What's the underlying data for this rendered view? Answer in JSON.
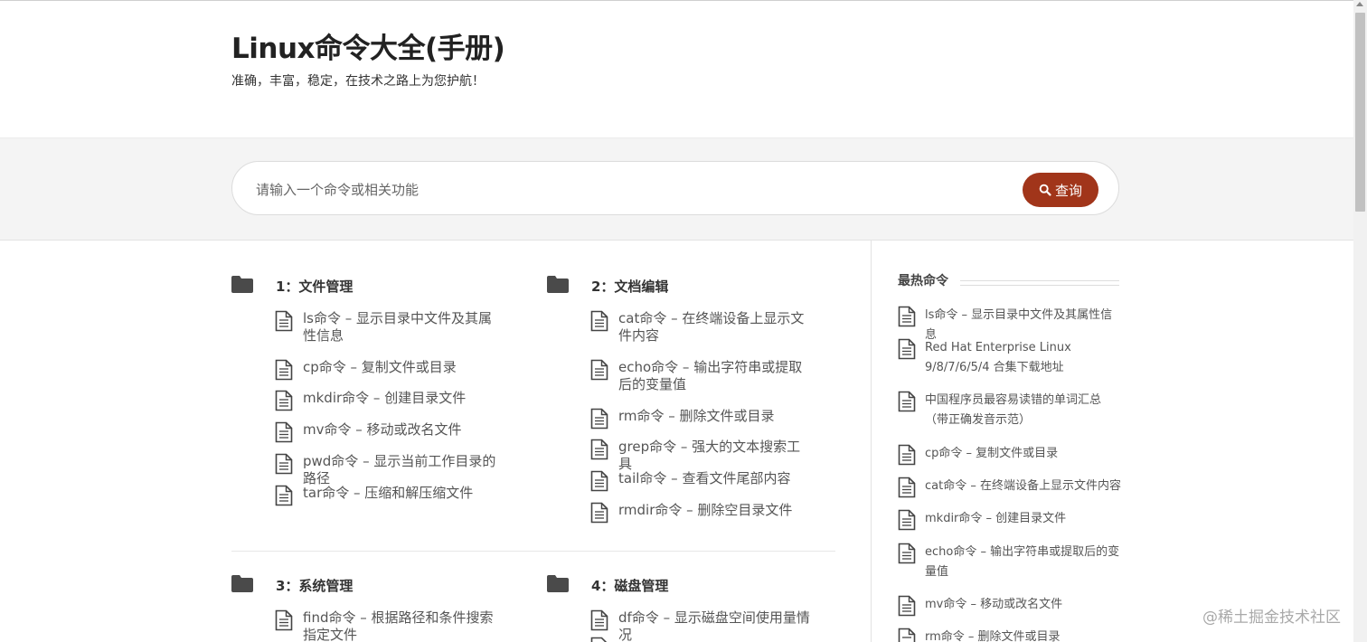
{
  "header": {
    "title": "Linux命令大全(手册)",
    "tagline": "准确，丰富，稳定，在技术之路上为您护航！"
  },
  "search": {
    "placeholder": "请输入一个命令或相关功能",
    "button_label": "查询"
  },
  "categories": [
    {
      "title": "1：文件管理",
      "items": [
        "ls命令 – 显示目录中文件及其属性信息",
        "cp命令 – 复制文件或目录",
        "mkdir命令 – 创建目录文件",
        "mv命令 – 移动或改名文件",
        "pwd命令 – 显示当前工作目录的路径",
        "tar命令 – 压缩和解压缩文件"
      ]
    },
    {
      "title": "2：文档编辑",
      "items": [
        "cat命令 – 在终端设备上显示文件内容",
        "echo命令 – 输出字符串或提取后的变量值",
        "rm命令 – 删除文件或目录",
        "grep命令 – 强大的文本搜索工具",
        "tail命令 – 查看文件尾部内容",
        "rmdir命令 – 删除空目录文件"
      ]
    },
    {
      "title": "3：系统管理",
      "items": [
        "find命令 – 根据路径和条件搜索指定文件"
      ]
    },
    {
      "title": "4：磁盘管理",
      "items": [
        "df命令 – 显示磁盘空间使用量情况"
      ]
    }
  ],
  "sidebar": {
    "title": "最热命令",
    "items": [
      "ls命令 – 显示目录中文件及其属性信息",
      "Red Hat Enterprise Linux 9/8/7/6/5/4 合集下载地址",
      "中国程序员最容易读错的单词汇总（带正确发音示范）",
      "cp命令 – 复制文件或目录",
      "cat命令 – 在终端设备上显示文件内容",
      "mkdir命令 – 创建目录文件",
      "echo命令 – 输出字符串或提取后的变量值",
      "mv命令 – 移动或改名文件",
      "rm命令 – 删除文件或目录"
    ]
  },
  "watermark": "@稀土掘金技术社区",
  "colors": {
    "accent": "#a1351a",
    "band": "#f4f4f4",
    "icon": "#4a4a4a"
  }
}
